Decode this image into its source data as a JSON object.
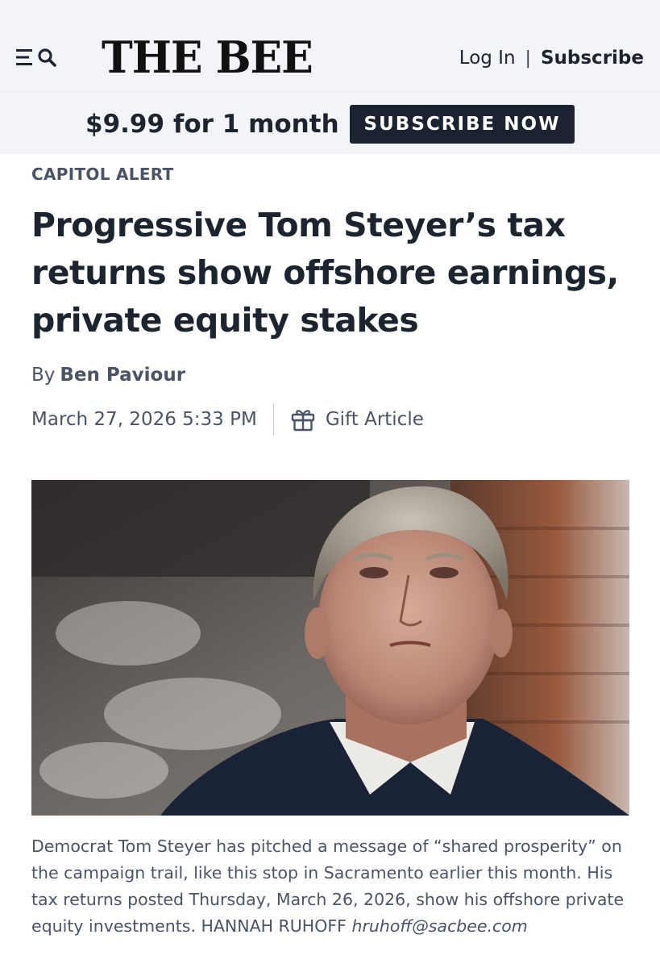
{
  "header": {
    "logo_text": "THE BEE",
    "login_label": "Log In",
    "separator": "|",
    "subscribe_label": "Subscribe"
  },
  "promo": {
    "offer_text": "$9.99 for 1 month",
    "button_label": "SUBSCRIBE NOW"
  },
  "article": {
    "section": "CAPITOL ALERT",
    "headline": "Progressive Tom Steyer’s tax returns show offshore earnings, private equity stakes",
    "byline_prefix": "By",
    "author": "Ben Paviour",
    "timestamp": "March 27, 2026 5:33 PM",
    "gift_label": "Gift Article",
    "caption_text": "Democrat Tom Steyer has pitched a message of “shared prosperity” on the campaign trail, like this stop in Sacramento earlier this month. His tax returns posted Thursday, March 26, 2026, show his offshore private equity investments. HANNAH RUHOFF ",
    "caption_email": "hruhoff@sacbee.com"
  },
  "icons": [
    "menu-icon",
    "search-icon",
    "gift-icon"
  ],
  "colors": {
    "header_bg": "#f3f4f8",
    "button_bg": "#1b2330",
    "text_primary": "#1c2430",
    "text_secondary": "#4a5466"
  }
}
